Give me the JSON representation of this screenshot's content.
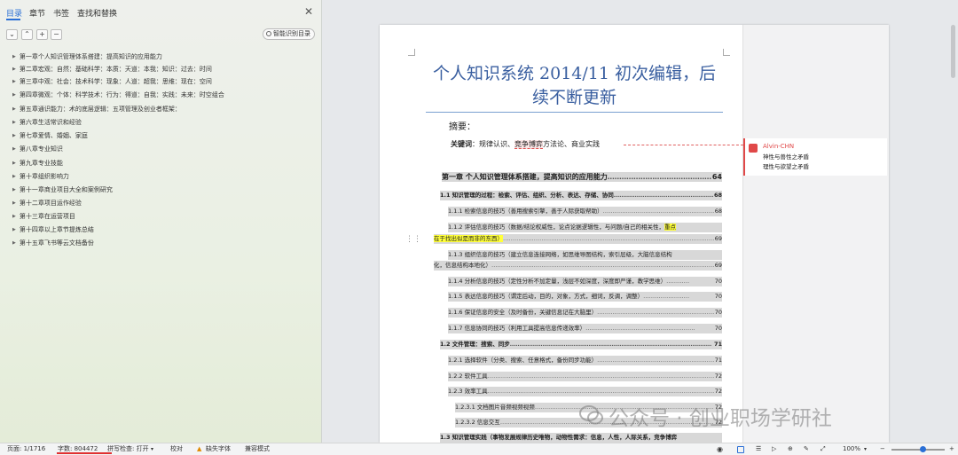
{
  "left_panel": {
    "tabs": [
      "目录",
      "章节",
      "书签",
      "查找和替换"
    ],
    "close_icon": "close-icon",
    "toolbar": {
      "collapse": "⌄",
      "expand": "⌃",
      "add": "+",
      "remove": "−",
      "smart_toc": "智能识别目录"
    },
    "toc_items": [
      "第一章个人知识管理体系搭建：提高知识的应用能力",
      "第二章宏观：自然：基础科学：本质：天道：本我：知识：过去：时间",
      "第三章中观：社会：技术科学：现象：人道：超我：思维：现在：空间",
      "第四章微观：个体：科学技术：行为：得道：自我：实践：未来：时空组合",
      "第五章通识能力：术的底层逻辑：五项管理及创业者框架：",
      "第六章生活常识和经验",
      "第七章爱情、婚姻、家庭",
      "第八章专业知识",
      "第九章专业技能",
      "第十章组织影响力",
      "第十一章商业项目大全和案例研究",
      "第十二章项目运作经验",
      "第十三章在运营项目",
      "第十四章以上章节提炼总结",
      "第十五章飞书等云文档备份"
    ]
  },
  "document": {
    "title": "个人知识系统 2014/11 初次编辑，后续不断更新",
    "abstract_label": "摘要：",
    "keywords_label": "关键词",
    "keywords_before": "：规律认识、",
    "keywords_highlight": "竞争博弈",
    "keywords_after": "方法论、商业实践",
    "toc_lines": [
      {
        "text": "第一章 个人知识管理体系搭建，提高知识的应用能力",
        "page": "64",
        "level": 1
      },
      {
        "text": "1.1 知识管理的过程：检索、评估、组织、分析、表达、存储、协同",
        "page": "68",
        "level": 2
      },
      {
        "text": "1.1.1 检索信息的技巧（善用搜索引擎，善于人际获取帮助）",
        "page": "68",
        "level": 3
      },
      {
        "text": "1.1.2 评估信息的技巧（数据/结论权威性，论点论据逻辑性，与问题/自己的相关性，",
        "highlight": "重点",
        "page": "",
        "level": 3
      },
      {
        "text": "",
        "highlight": "在于找出似是而非的东西）",
        "page": "69",
        "level": 3,
        "continuation": true
      },
      {
        "text": "1.1.3 组织信息的技巧（建立信息连接网络，如思维导图结构，索引层级，大脑信息结构",
        "page": "",
        "level": 3
      },
      {
        "text": "化，信息结构本地化）",
        "page": "69",
        "level": 3,
        "continuation": true
      },
      {
        "text": "1.1.4 分析信息的技巧（定性分析不加定量，浅层不如深度，深度即严谨，教学思维）",
        "page": "70",
        "level": 3
      },
      {
        "text": "1.1.5 表达信息的技巧（谓定后动，目的，对象，方式，细词，反调，调整）",
        "page": "70",
        "level": 3
      },
      {
        "text": "1.1.6 保证信息的安全（及时备份，关键信息记在大脑里）",
        "page": "70",
        "level": 3
      },
      {
        "text": "1.1.7 信息协同的技巧（利用工具提高信息传递效率）",
        "page": "70",
        "level": 3
      },
      {
        "text": "1.2 文件管理：搜索、同步",
        "page": "71",
        "level": 2
      },
      {
        "text": "1.2.1 选择软件（分类、搜索、任意格式，备份同步功能）",
        "page": "71",
        "level": 3
      },
      {
        "text": "1.2.2 软件工具",
        "page": "72",
        "level": 3
      },
      {
        "text": "1.2.3 效率工具",
        "page": "72",
        "level": 3
      },
      {
        "text": "1.2.3.1 文档图片音频视频视频",
        "page": "72",
        "level": 4
      },
      {
        "text": "1.2.3.2 信息交互",
        "page": "72",
        "level": 4
      },
      {
        "text": "1.3 知识管理实践（事物发展规律历史唯物，动物性需求：信息，人性，人际关系，竞争博弈",
        "page": "",
        "level": 2
      }
    ]
  },
  "comment": {
    "author": "Alvin-CHN",
    "lines": [
      "神性与兽性之矛盾",
      "理性与欲望之矛盾"
    ]
  },
  "watermark": "公众号 · 创业职场学研社",
  "status_bar": {
    "page": "页面: 1/1716",
    "word_count": "字数: 804472",
    "spell_check": "拼写检查: 打开",
    "proofread": "校对",
    "missing_font": "缺失字体",
    "compat_mode": "兼容模式",
    "zoom": "100%"
  }
}
